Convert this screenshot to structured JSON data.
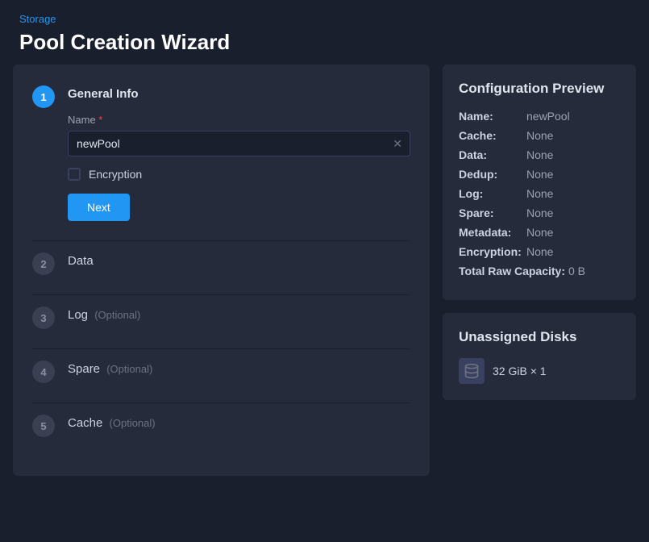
{
  "breadcrumb": {
    "label": "Storage"
  },
  "pageTitle": "Pool Creation Wizard",
  "steps": [
    {
      "number": "1",
      "label": "General Info",
      "active": true,
      "optional": false,
      "form": {
        "nameLabel": "Name",
        "nameRequired": true,
        "nameValue": "newPool",
        "namePlaceholder": "",
        "encryptionLabel": "Encryption",
        "nextLabel": "Next"
      }
    },
    {
      "number": "2",
      "label": "Data",
      "active": false,
      "optional": false
    },
    {
      "number": "3",
      "label": "Log",
      "active": false,
      "optional": true,
      "optionalText": "(Optional)"
    },
    {
      "number": "4",
      "label": "Spare",
      "active": false,
      "optional": true,
      "optionalText": "(Optional)"
    },
    {
      "number": "5",
      "label": "Cache",
      "active": false,
      "optional": true,
      "optionalText": "(Optional)"
    }
  ],
  "configPreview": {
    "title": "Configuration Preview",
    "rows": [
      {
        "key": "Name:",
        "value": "newPool"
      },
      {
        "key": "Cache:",
        "value": "None"
      },
      {
        "key": "Data:",
        "value": "None"
      },
      {
        "key": "Dedup:",
        "value": "None"
      },
      {
        "key": "Log:",
        "value": "None"
      },
      {
        "key": "Spare:",
        "value": "None"
      },
      {
        "key": "Metadata:",
        "value": "None"
      },
      {
        "key": "Encryption:",
        "value": "None"
      },
      {
        "key": "Total Raw Capacity:",
        "value": "0 B"
      }
    ]
  },
  "unassignedDisks": {
    "title": "Unassigned Disks",
    "disks": [
      {
        "size": "32 GiB",
        "count": "× 1"
      }
    ]
  }
}
